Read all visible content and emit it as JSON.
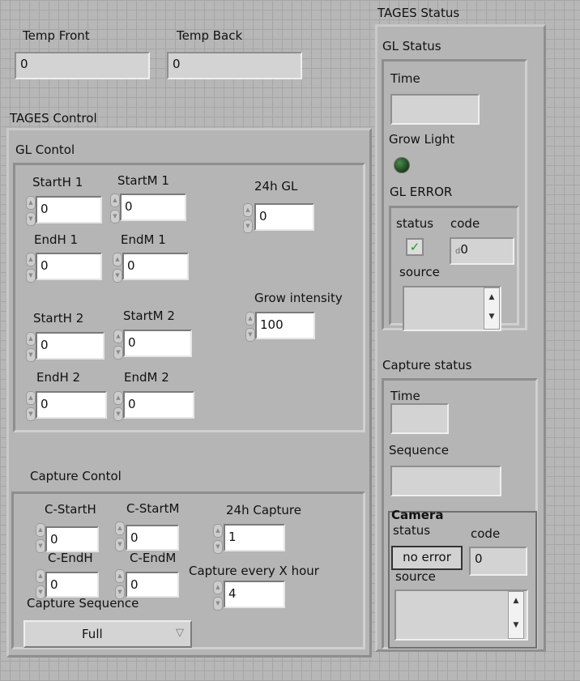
{
  "temps": {
    "front_label": "Temp Front",
    "front_value": "0",
    "back_label": "Temp Back",
    "back_value": "0"
  },
  "control": {
    "title": "TAGES Control",
    "gl": {
      "title": "GL Contol",
      "start_h1_label": "StartH 1",
      "start_h1": "0",
      "start_m1_label": "StartM 1",
      "start_m1": "0",
      "end_h1_label": "EndH 1",
      "end_h1": "0",
      "end_m1_label": "EndM 1",
      "end_m1": "0",
      "start_h2_label": "StartH 2",
      "start_h2": "0",
      "start_m2_label": "StartM 2",
      "start_m2": "0",
      "end_h2_label": "EndH 2",
      "end_h2": "0",
      "end_m2_label": "EndM 2",
      "end_m2": "0",
      "h24_label": "24h GL",
      "h24": "0",
      "intensity_label": "Grow intensity",
      "intensity": "100"
    },
    "capture": {
      "title": "Capture Contol",
      "start_h_label": "C-StartH",
      "start_h": "0",
      "start_m_label": "C-StartM",
      "start_m": "0",
      "end_h_label": "C-EndH",
      "end_h": "0",
      "end_m_label": "C-EndM",
      "end_m": "0",
      "h24_label": "24h Capture",
      "h24": "1",
      "every_label": "Capture every X hour",
      "every": "4",
      "sequence_label": "Capture Sequence",
      "sequence": "Full"
    }
  },
  "status": {
    "title": "TAGES Status",
    "gl": {
      "title": "GL Status",
      "time_label": "Time",
      "time": "",
      "grow_light_label": "Grow Light",
      "error": {
        "title": "GL ERROR",
        "status_label": "status",
        "code_label": "code",
        "code": "0",
        "source_label": "source",
        "source": ""
      }
    },
    "capture": {
      "title": "Capture status",
      "time_label": "Time",
      "time": "",
      "sequence_label": "Sequence",
      "sequence": "",
      "camera": {
        "title": "Camera",
        "status_label": "status",
        "status_text": "no error",
        "code_label": "code",
        "code": "0",
        "source_label": "source",
        "source": ""
      }
    }
  },
  "colors": {
    "led_off": "#1f4a1f",
    "check": "#1a9a1a"
  },
  "icons": {
    "spinner": "up-down-arrows",
    "dropdown": "triangle-down",
    "check": "check-mark"
  }
}
